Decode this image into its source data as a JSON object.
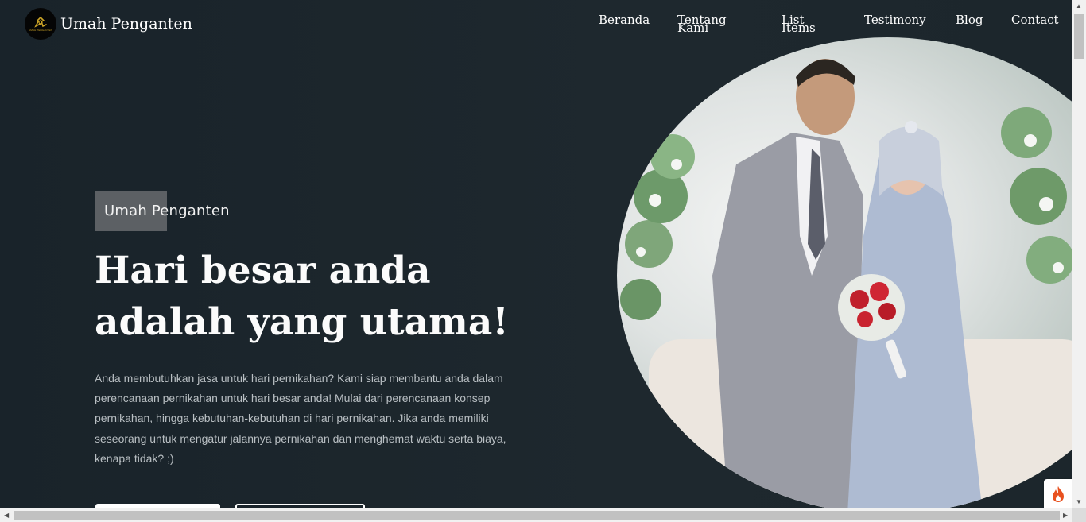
{
  "header": {
    "brand": "Umah Penganten",
    "logo_text": "UMAH PENGANTEN",
    "nav": [
      "Beranda",
      "Tentang Kami",
      "List Items",
      "Testimony",
      "Blog",
      "Contact"
    ]
  },
  "hero": {
    "tag": "Umah Penganten",
    "headline": "Hari besar anda adalah yang utama!",
    "description": "Anda membutuhkan jasa untuk hari pernikahan? Kami siap membantu anda dalam perencanaan pernikahan untuk hari besar anda! Mulai dari perencanaan konsep pernikahan, hingga kebutuhan-kebutuhan di hari pernikahan. Jika anda memiliki seseorang untuk mengatur jalannya pernikahan dan menghemat waktu serta biaya, kenapa tidak? ;)",
    "image": "wedding-couple-photo"
  },
  "colors": {
    "background": "#1a2329",
    "tag_box": "#5c6064",
    "logo_gold": "#c9a227",
    "fire_icon": "#e8511f"
  },
  "icons": {
    "floating_button": "fire-icon"
  }
}
